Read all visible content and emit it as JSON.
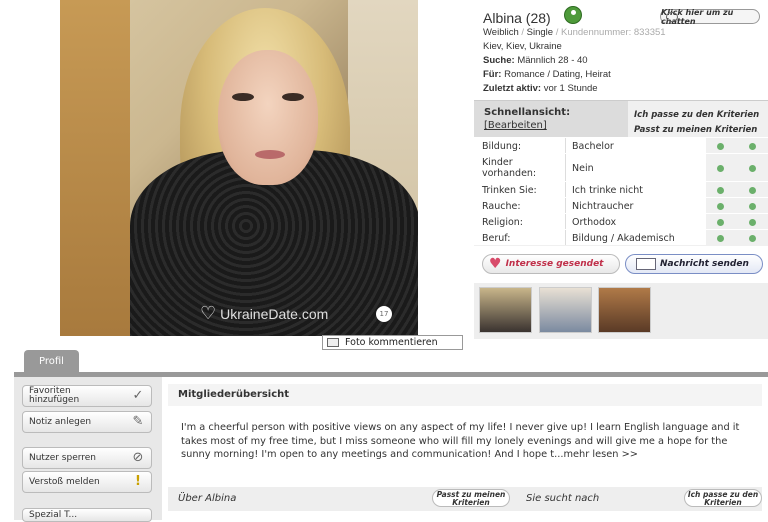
{
  "photo": {
    "watermark": "UkraineDate.com",
    "badge": "17",
    "comment_button": "Foto kommentieren"
  },
  "profile": {
    "name": "Albina (28)",
    "online_icon": "online-person-icon",
    "chat_button": "Klick hier um zu chatten",
    "gender": "Weiblich",
    "status": "Single",
    "member_number": "Kundennummer: 833351",
    "location": "Kiev, Kiev, Ukraine",
    "search_label": "Suche:",
    "search_value": "Männlich 28 - 40",
    "for_label": "Für:",
    "for_value": "Romance / Dating, Heirat",
    "last_active_label": "Zuletzt aktiv:",
    "last_active_value": "vor 1 Stunde"
  },
  "criteria": {
    "title": "Schnellansicht:",
    "edit_link": "[Bearbeiten]",
    "col1": "Ich passe zu den Kriterien",
    "col2": "Passt zu meinen Kriterien",
    "rows": [
      {
        "label": "Bildung:",
        "value": "Bachelor"
      },
      {
        "label": "Kinder vorhanden:",
        "value": "Nein"
      },
      {
        "label": "Trinken Sie:",
        "value": "Ich trinke nicht"
      },
      {
        "label": "Rauche:",
        "value": "Nichtraucher"
      },
      {
        "label": "Religion:",
        "value": "Orthodox"
      },
      {
        "label": "Beruf:",
        "value": "Bildung / Akademisch"
      }
    ],
    "match_color": "#6bb06b"
  },
  "actions": {
    "interest": "Interesse gesendet",
    "message": "Nachricht senden"
  },
  "tabs": {
    "profile": "Profil"
  },
  "sidebar": {
    "favorites": "Favoriten hinzufügen",
    "note": "Notiz anlegen",
    "block": "Nutzer sperren",
    "report": "Verstoß melden",
    "partial": "Spezial T..."
  },
  "main": {
    "overview_title": "Mitgliederübersicht",
    "about_text": "I'm a cheerful person with positive views on any aspect of my life! I never give up! I learn English language and it takes most of my free time, but I miss someone who will fill my lonely evenings and will give me a hope for the sunny morning! I'm open to any meetings and communication! And I hope t...mehr lesen >>",
    "about_label": "Über Albina",
    "about_pill": "Passt zu meinen Kriterien",
    "seeks_label": "Sie sucht nach",
    "seeks_pill": "Ich passe zu den Kriterien"
  }
}
